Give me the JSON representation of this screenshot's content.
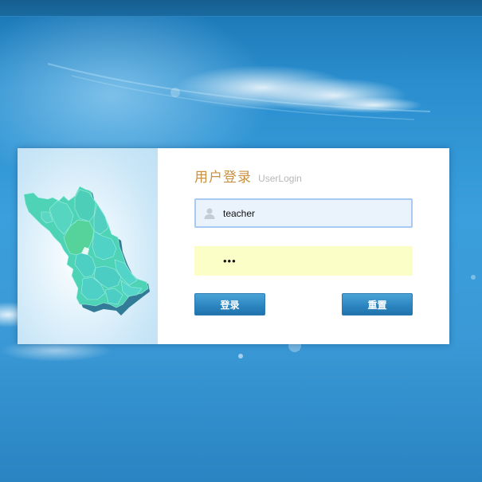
{
  "login": {
    "title": "用户登录",
    "subtitle": "UserLogin",
    "username_value": "teacher",
    "password_value": "•••",
    "login_button": "登录",
    "reset_button": "重置"
  },
  "icons": {
    "username": "user-icon",
    "map": "jiangsu-map-illustration"
  },
  "colors": {
    "title": "#c9913f",
    "button": "#2d86c1",
    "username_field_bg": "#eaf3fb",
    "password_field_bg": "#fbfec6",
    "map_fill": "#4fd3b6"
  }
}
